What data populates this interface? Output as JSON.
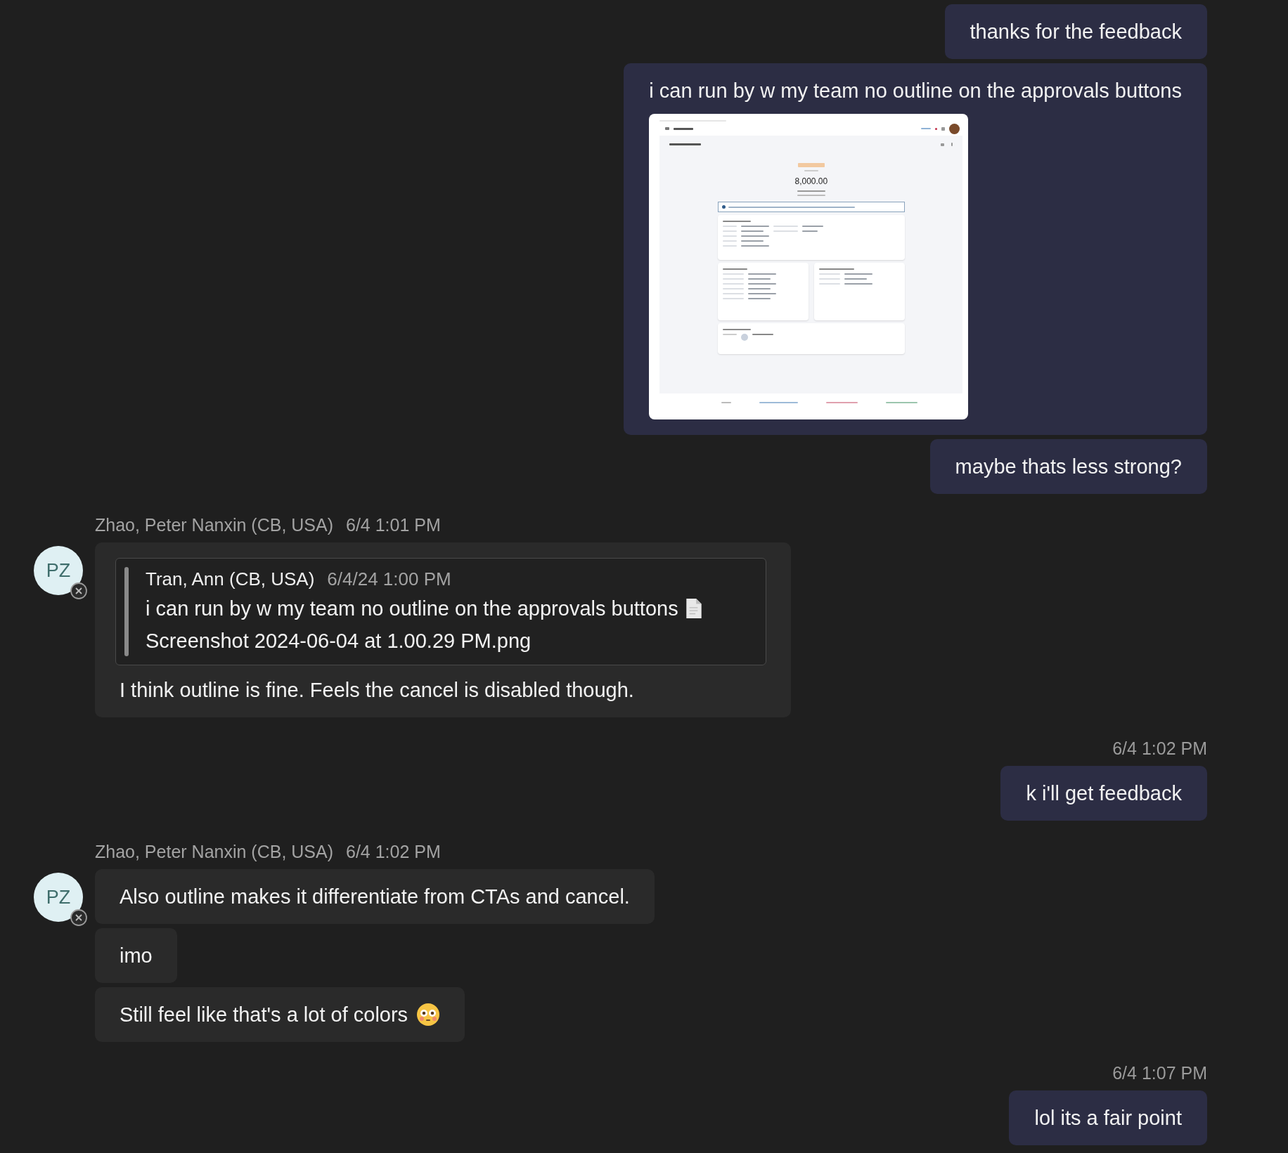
{
  "feed": [
    {
      "kind": "outgoing",
      "bubbles": [
        {
          "text": "thanks for the feedback"
        },
        {
          "text": "i can run by w my team no outline on the approvals buttons",
          "attachment": {
            "amount": "8,000.00"
          }
        },
        {
          "text": "maybe thats less strong?"
        }
      ]
    },
    {
      "kind": "incoming",
      "sender": "Zhao, Peter Nanxin (CB, USA)",
      "time": "6/4 1:01 PM",
      "initials": "PZ",
      "bubbles": [
        {
          "quote": {
            "author": "Tran, Ann (CB, USA)",
            "time": "6/4/24 1:00 PM",
            "text": "i can run by w my team no outline on the approvals buttons",
            "file": "Screenshot 2024-06-04 at 1.00.29 PM.png"
          },
          "text": "I think outline is fine. Feels the cancel is disabled though."
        }
      ]
    },
    {
      "kind": "outgoing",
      "time": "6/4 1:02 PM",
      "bubbles": [
        {
          "text": "k i'll get feedback"
        }
      ]
    },
    {
      "kind": "incoming",
      "sender": "Zhao, Peter Nanxin (CB, USA)",
      "time": "6/4 1:02 PM",
      "initials": "PZ",
      "bubbles": [
        {
          "text": "Also outline makes it differentiate from CTAs and cancel."
        },
        {
          "text": "imo"
        },
        {
          "text": "Still feel like that's a lot of colors",
          "emoji": true
        }
      ]
    },
    {
      "kind": "outgoing",
      "time": "6/4 1:07 PM",
      "bubbles": [
        {
          "text": "lol its a fair point"
        }
      ]
    }
  ]
}
